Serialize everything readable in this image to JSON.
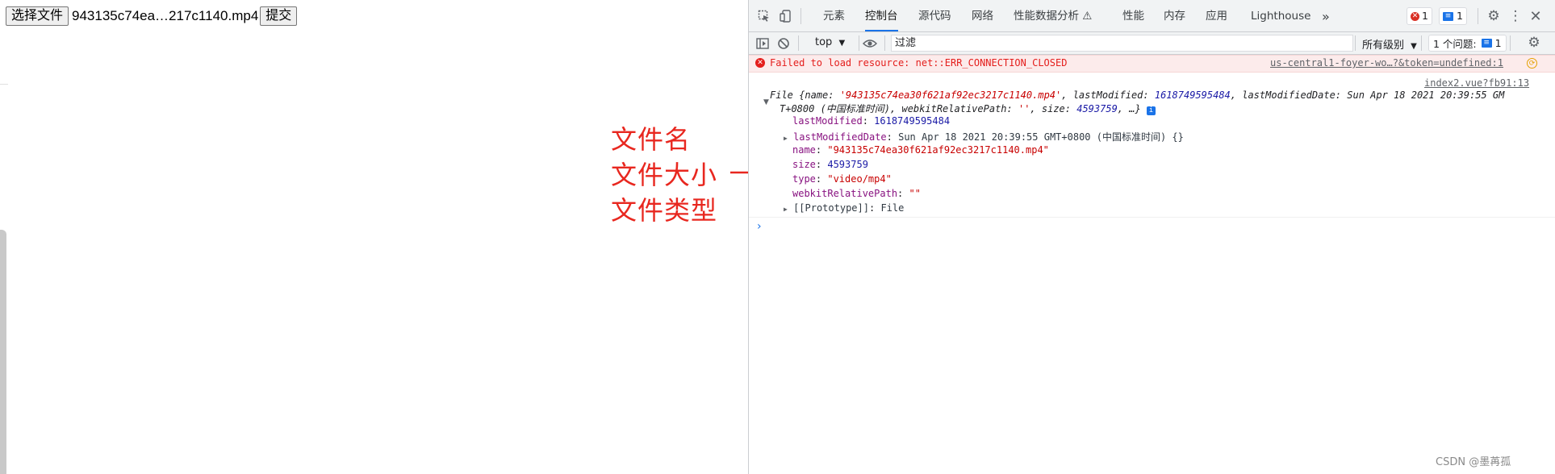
{
  "page": {
    "choose_file_label": "选择文件",
    "file_name": "943135c74ea…217c1140.mp4",
    "submit_label": "提交"
  },
  "annotation": {
    "line1": "文件名",
    "line2": "文件大小",
    "line3": "文件类型",
    "color": "#e8271f"
  },
  "devtools": {
    "tabs": [
      "元素",
      "控制台",
      "源代码",
      "网络",
      "性能数据分析 ⚠",
      "性能",
      "内存",
      "应用",
      "Lighthouse"
    ],
    "active_tab": "控制台",
    "more_tabs": "»",
    "error_count": "1",
    "message_count": "1",
    "toolbar": {
      "context": "top",
      "filter_placeholder": "过滤",
      "levels": "所有级别",
      "issues_label": "1 个问题:",
      "issues_count": "1"
    },
    "console": {
      "error_text": "Failed to load resource: net::ERR_CONNECTION_CLOSED",
      "error_source": "us-central1-foyer-wo…?&token=undefined:1",
      "source_link": "index2.vue?fb91:13",
      "file_summary_prefix": "File {name: ",
      "file_summary_name": "'943135c74ea30f621af92ec3217c1140.mp4'",
      "file_summary_mid1": ", lastModified: ",
      "file_summary_lm": "1618749595484",
      "file_summary_mid2": ", lastModifiedDate: Sun Apr 18 2021 20:39:55 GM",
      "file_summary_line2a": "T+0800 (中国标准时间), webkitRelativePath: ",
      "file_summary_wrp": "''",
      "file_summary_line2b": ", size: ",
      "file_summary_size": "4593759",
      "file_summary_end": ", …}",
      "props": {
        "lastModified_key": "lastModified",
        "lastModified_val": "1618749595484",
        "lastModifiedDate_key": "lastModifiedDate",
        "lastModifiedDate_val": "Sun Apr 18 2021 20:39:55 GMT+0800 (中国标准时间) {}",
        "name_key": "name",
        "name_val": "\"943135c74ea30f621af92ec3217c1140.mp4\"",
        "size_key": "size",
        "size_val": "4593759",
        "type_key": "type",
        "type_val": "\"video/mp4\"",
        "webkitRelativePath_key": "webkitRelativePath",
        "webkitRelativePath_val": "\"\"",
        "prototype_key": "[[Prototype]]",
        "prototype_val": "File"
      },
      "prompt": "›"
    }
  },
  "watermark": "CSDN @墨苒孤"
}
